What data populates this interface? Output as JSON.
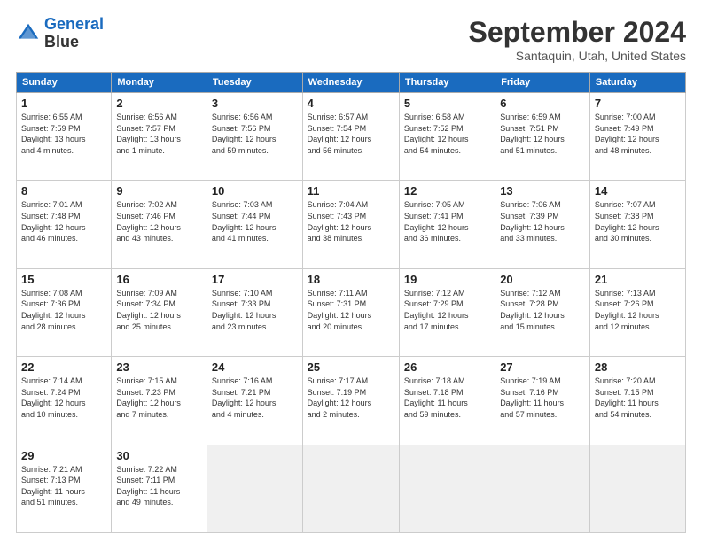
{
  "header": {
    "logo_line1": "General",
    "logo_line2": "Blue",
    "month": "September 2024",
    "location": "Santaquin, Utah, United States"
  },
  "days_of_week": [
    "Sunday",
    "Monday",
    "Tuesday",
    "Wednesday",
    "Thursday",
    "Friday",
    "Saturday"
  ],
  "weeks": [
    [
      {
        "day": "1",
        "info": "Sunrise: 6:55 AM\nSunset: 7:59 PM\nDaylight: 13 hours\nand 4 minutes."
      },
      {
        "day": "2",
        "info": "Sunrise: 6:56 AM\nSunset: 7:57 PM\nDaylight: 13 hours\nand 1 minute."
      },
      {
        "day": "3",
        "info": "Sunrise: 6:56 AM\nSunset: 7:56 PM\nDaylight: 12 hours\nand 59 minutes."
      },
      {
        "day": "4",
        "info": "Sunrise: 6:57 AM\nSunset: 7:54 PM\nDaylight: 12 hours\nand 56 minutes."
      },
      {
        "day": "5",
        "info": "Sunrise: 6:58 AM\nSunset: 7:52 PM\nDaylight: 12 hours\nand 54 minutes."
      },
      {
        "day": "6",
        "info": "Sunrise: 6:59 AM\nSunset: 7:51 PM\nDaylight: 12 hours\nand 51 minutes."
      },
      {
        "day": "7",
        "info": "Sunrise: 7:00 AM\nSunset: 7:49 PM\nDaylight: 12 hours\nand 48 minutes."
      }
    ],
    [
      {
        "day": "8",
        "info": "Sunrise: 7:01 AM\nSunset: 7:48 PM\nDaylight: 12 hours\nand 46 minutes."
      },
      {
        "day": "9",
        "info": "Sunrise: 7:02 AM\nSunset: 7:46 PM\nDaylight: 12 hours\nand 43 minutes."
      },
      {
        "day": "10",
        "info": "Sunrise: 7:03 AM\nSunset: 7:44 PM\nDaylight: 12 hours\nand 41 minutes."
      },
      {
        "day": "11",
        "info": "Sunrise: 7:04 AM\nSunset: 7:43 PM\nDaylight: 12 hours\nand 38 minutes."
      },
      {
        "day": "12",
        "info": "Sunrise: 7:05 AM\nSunset: 7:41 PM\nDaylight: 12 hours\nand 36 minutes."
      },
      {
        "day": "13",
        "info": "Sunrise: 7:06 AM\nSunset: 7:39 PM\nDaylight: 12 hours\nand 33 minutes."
      },
      {
        "day": "14",
        "info": "Sunrise: 7:07 AM\nSunset: 7:38 PM\nDaylight: 12 hours\nand 30 minutes."
      }
    ],
    [
      {
        "day": "15",
        "info": "Sunrise: 7:08 AM\nSunset: 7:36 PM\nDaylight: 12 hours\nand 28 minutes."
      },
      {
        "day": "16",
        "info": "Sunrise: 7:09 AM\nSunset: 7:34 PM\nDaylight: 12 hours\nand 25 minutes."
      },
      {
        "day": "17",
        "info": "Sunrise: 7:10 AM\nSunset: 7:33 PM\nDaylight: 12 hours\nand 23 minutes."
      },
      {
        "day": "18",
        "info": "Sunrise: 7:11 AM\nSunset: 7:31 PM\nDaylight: 12 hours\nand 20 minutes."
      },
      {
        "day": "19",
        "info": "Sunrise: 7:12 AM\nSunset: 7:29 PM\nDaylight: 12 hours\nand 17 minutes."
      },
      {
        "day": "20",
        "info": "Sunrise: 7:12 AM\nSunset: 7:28 PM\nDaylight: 12 hours\nand 15 minutes."
      },
      {
        "day": "21",
        "info": "Sunrise: 7:13 AM\nSunset: 7:26 PM\nDaylight: 12 hours\nand 12 minutes."
      }
    ],
    [
      {
        "day": "22",
        "info": "Sunrise: 7:14 AM\nSunset: 7:24 PM\nDaylight: 12 hours\nand 10 minutes."
      },
      {
        "day": "23",
        "info": "Sunrise: 7:15 AM\nSunset: 7:23 PM\nDaylight: 12 hours\nand 7 minutes."
      },
      {
        "day": "24",
        "info": "Sunrise: 7:16 AM\nSunset: 7:21 PM\nDaylight: 12 hours\nand 4 minutes."
      },
      {
        "day": "25",
        "info": "Sunrise: 7:17 AM\nSunset: 7:19 PM\nDaylight: 12 hours\nand 2 minutes."
      },
      {
        "day": "26",
        "info": "Sunrise: 7:18 AM\nSunset: 7:18 PM\nDaylight: 11 hours\nand 59 minutes."
      },
      {
        "day": "27",
        "info": "Sunrise: 7:19 AM\nSunset: 7:16 PM\nDaylight: 11 hours\nand 57 minutes."
      },
      {
        "day": "28",
        "info": "Sunrise: 7:20 AM\nSunset: 7:15 PM\nDaylight: 11 hours\nand 54 minutes."
      }
    ],
    [
      {
        "day": "29",
        "info": "Sunrise: 7:21 AM\nSunset: 7:13 PM\nDaylight: 11 hours\nand 51 minutes."
      },
      {
        "day": "30",
        "info": "Sunrise: 7:22 AM\nSunset: 7:11 PM\nDaylight: 11 hours\nand 49 minutes."
      },
      {
        "day": "",
        "info": ""
      },
      {
        "day": "",
        "info": ""
      },
      {
        "day": "",
        "info": ""
      },
      {
        "day": "",
        "info": ""
      },
      {
        "day": "",
        "info": ""
      }
    ]
  ]
}
